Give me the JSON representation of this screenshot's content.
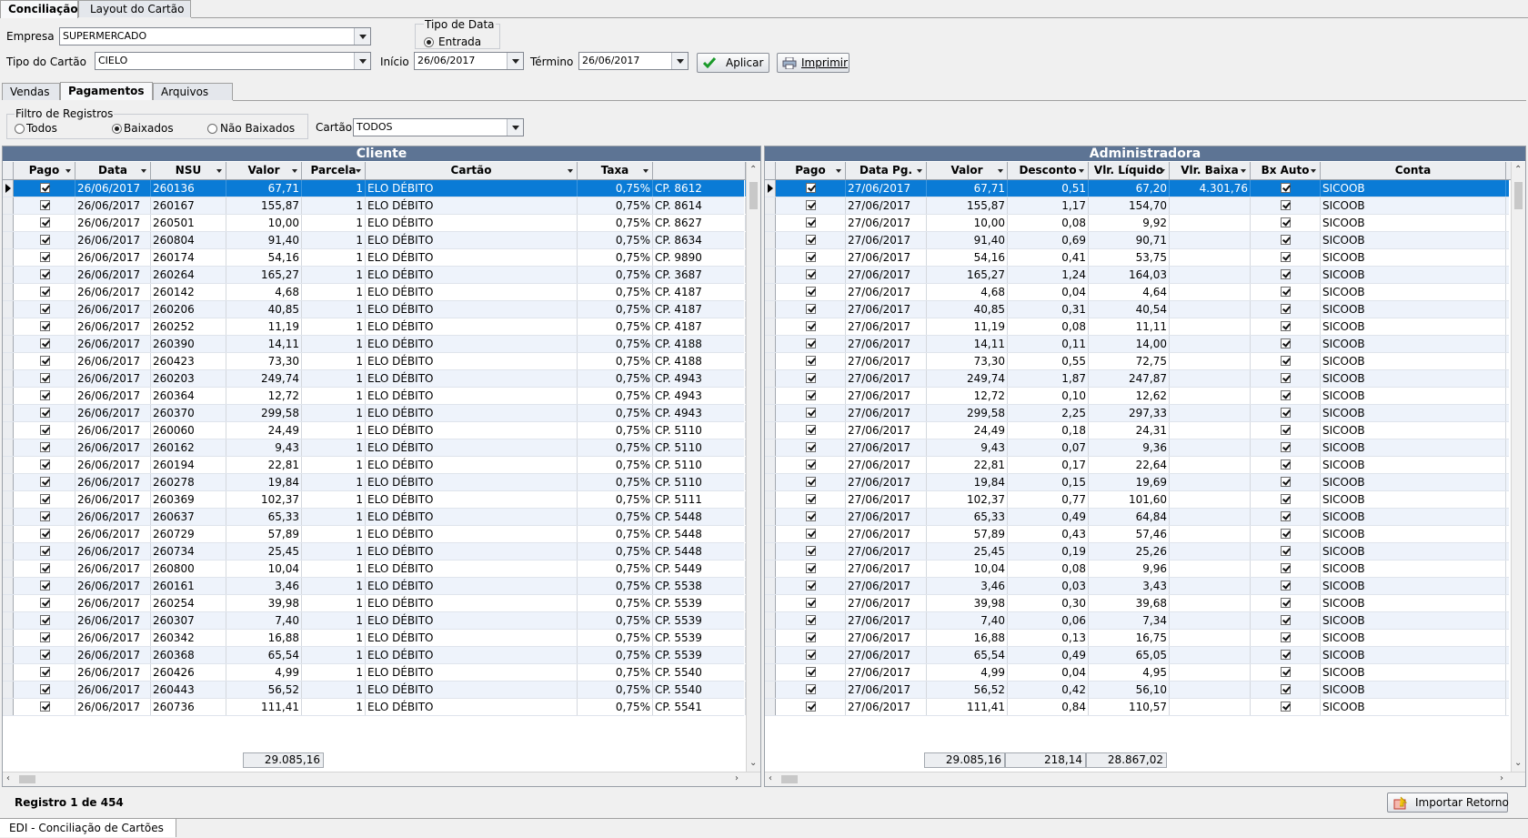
{
  "main_tabs": [
    "Conciliação",
    "Layout do Cartão"
  ],
  "filters": {
    "empresa_label": "Empresa",
    "empresa_value": "SUPERMERCADO",
    "tipo_cartao_label": "Tipo do Cartão",
    "tipo_cartao_value": "CIELO",
    "tipo_data_title": "Tipo de Data",
    "tipo_data_option": "Entrada",
    "inicio_label": "Início",
    "inicio_value": "26/06/2017",
    "termino_label": "Término",
    "termino_value": "26/06/2017",
    "aplicar_label": "Aplicar",
    "imprimir_label": "Imprimir"
  },
  "sub_tabs": [
    "Vendas",
    "Pagamentos",
    "Arquivos"
  ],
  "registro_filter": {
    "title": "Filtro de Registros",
    "options": [
      "Todos",
      "Baixados",
      "Não Baixados"
    ],
    "selected": "Baixados",
    "cartao_label": "Cartão",
    "cartao_value": "TODOS"
  },
  "cliente": {
    "title": "Cliente",
    "columns": [
      "Pago",
      "Data",
      "NSU",
      "Valor",
      "Parcela",
      "Cartão",
      "Taxa",
      ""
    ],
    "card_name": "ELO DÉBITO",
    "rate": "0,75%",
    "parcela": "1",
    "date": "26/06/2017",
    "rows": [
      [
        "260136",
        "67,71",
        "CP. 8612"
      ],
      [
        "260167",
        "155,87",
        "CP. 8614"
      ],
      [
        "260501",
        "10,00",
        "CP. 8627"
      ],
      [
        "260804",
        "91,40",
        "CP. 8634"
      ],
      [
        "260174",
        "54,16",
        "CP. 9890"
      ],
      [
        "260264",
        "165,27",
        "CP. 3687"
      ],
      [
        "260142",
        "4,68",
        "CP. 4187"
      ],
      [
        "260206",
        "40,85",
        "CP. 4187"
      ],
      [
        "260252",
        "11,19",
        "CP. 4187"
      ],
      [
        "260390",
        "14,11",
        "CP. 4188"
      ],
      [
        "260423",
        "73,30",
        "CP. 4188"
      ],
      [
        "260203",
        "249,74",
        "CP. 4943"
      ],
      [
        "260364",
        "12,72",
        "CP. 4943"
      ],
      [
        "260370",
        "299,58",
        "CP. 4943"
      ],
      [
        "260060",
        "24,49",
        "CP. 5110"
      ],
      [
        "260162",
        "9,43",
        "CP. 5110"
      ],
      [
        "260194",
        "22,81",
        "CP. 5110"
      ],
      [
        "260278",
        "19,84",
        "CP. 5110"
      ],
      [
        "260369",
        "102,37",
        "CP. 5111"
      ],
      [
        "260637",
        "65,33",
        "CP. 5448"
      ],
      [
        "260729",
        "57,89",
        "CP. 5448"
      ],
      [
        "260734",
        "25,45",
        "CP. 5448"
      ],
      [
        "260800",
        "10,04",
        "CP. 5449"
      ],
      [
        "260161",
        "3,46",
        "CP. 5538"
      ],
      [
        "260254",
        "39,98",
        "CP. 5539"
      ],
      [
        "260307",
        "7,40",
        "CP. 5539"
      ],
      [
        "260342",
        "16,88",
        "CP. 5539"
      ],
      [
        "260368",
        "65,54",
        "CP. 5539"
      ],
      [
        "260426",
        "4,99",
        "CP. 5540"
      ],
      [
        "260443",
        "56,52",
        "CP. 5540"
      ],
      [
        "260736",
        "111,41",
        "CP. 5541"
      ]
    ],
    "total_valor": "29.085,16"
  },
  "administradora": {
    "title": "Administradora",
    "columns": [
      "Pago",
      "Data Pg.",
      "Valor",
      "Desconto",
      "Vlr. Líquido",
      "Vlr. Baixa",
      "Bx Auto",
      "Conta"
    ],
    "date": "27/06/2017",
    "conta": "SICOOB",
    "first_baixa": "4.301,76",
    "rows": [
      [
        "67,71",
        "0,51",
        "67,20"
      ],
      [
        "155,87",
        "1,17",
        "154,70"
      ],
      [
        "10,00",
        "0,08",
        "9,92"
      ],
      [
        "91,40",
        "0,69",
        "90,71"
      ],
      [
        "54,16",
        "0,41",
        "53,75"
      ],
      [
        "165,27",
        "1,24",
        "164,03"
      ],
      [
        "4,68",
        "0,04",
        "4,64"
      ],
      [
        "40,85",
        "0,31",
        "40,54"
      ],
      [
        "11,19",
        "0,08",
        "11,11"
      ],
      [
        "14,11",
        "0,11",
        "14,00"
      ],
      [
        "73,30",
        "0,55",
        "72,75"
      ],
      [
        "249,74",
        "1,87",
        "247,87"
      ],
      [
        "12,72",
        "0,10",
        "12,62"
      ],
      [
        "299,58",
        "2,25",
        "297,33"
      ],
      [
        "24,49",
        "0,18",
        "24,31"
      ],
      [
        "9,43",
        "0,07",
        "9,36"
      ],
      [
        "22,81",
        "0,17",
        "22,64"
      ],
      [
        "19,84",
        "0,15",
        "19,69"
      ],
      [
        "102,37",
        "0,77",
        "101,60"
      ],
      [
        "65,33",
        "0,49",
        "64,84"
      ],
      [
        "57,89",
        "0,43",
        "57,46"
      ],
      [
        "25,45",
        "0,19",
        "25,26"
      ],
      [
        "10,04",
        "0,08",
        "9,96"
      ],
      [
        "3,46",
        "0,03",
        "3,43"
      ],
      [
        "39,98",
        "0,30",
        "39,68"
      ],
      [
        "7,40",
        "0,06",
        "7,34"
      ],
      [
        "16,88",
        "0,13",
        "16,75"
      ],
      [
        "65,54",
        "0,49",
        "65,05"
      ],
      [
        "4,99",
        "0,04",
        "4,95"
      ],
      [
        "56,52",
        "0,42",
        "56,10"
      ],
      [
        "111,41",
        "0,84",
        "110,57"
      ]
    ],
    "total_valor": "29.085,16",
    "total_desconto": "218,14",
    "total_liquido": "28.867,02"
  },
  "footer": {
    "registro": "Registro 1 de 454",
    "importar_label": "Importar Retorno"
  },
  "status_tab": "EDI - Conciliação de Cartões",
  "colors": {
    "header_bar": "#5d7494",
    "selection": "#0a7bd6",
    "alt_row": "#eef3fb"
  },
  "icons": [
    "check-icon",
    "printer-icon",
    "import-icon"
  ]
}
